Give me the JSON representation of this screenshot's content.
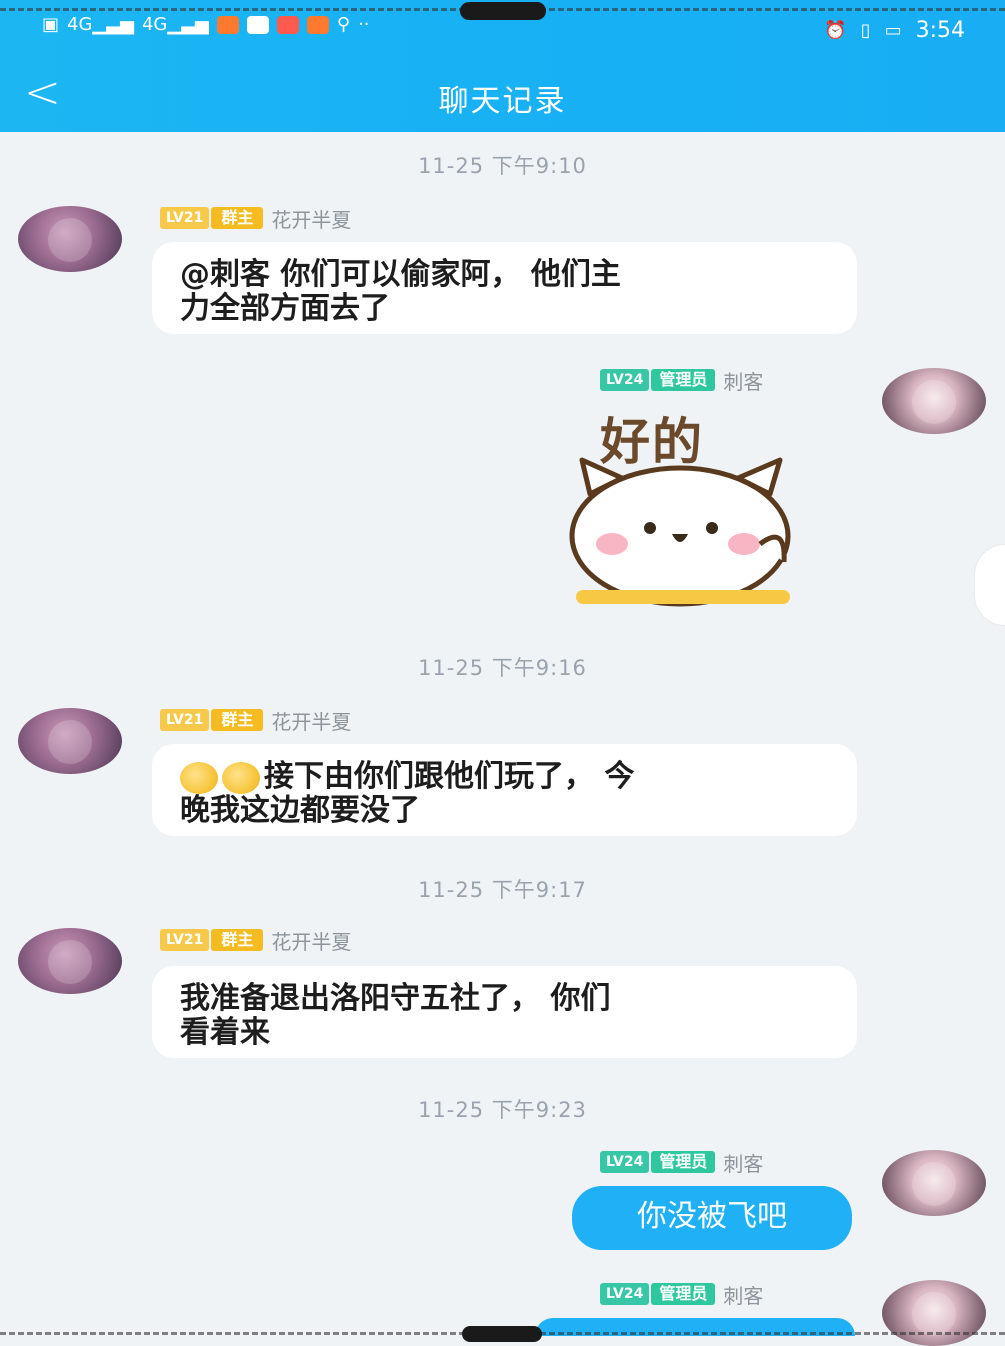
{
  "status_bar": {
    "left_icons": [
      "hd-icon",
      "signal-icon",
      "signal-icon",
      "app-icon",
      "app-icon",
      "app-icon",
      "app-icon",
      "search-icon",
      "more-dots-icon"
    ],
    "signal_label_1": "4G",
    "signal_label_2": "4G",
    "time": "3:54",
    "right_icons": [
      "alarm-icon",
      "vibrate-icon",
      "battery-icon"
    ]
  },
  "nav": {
    "back_label": "<",
    "title": "聊天记录"
  },
  "messages": [
    {
      "timestamp": "11-25 下午9:10",
      "level": "LV21",
      "role": "群主",
      "nickname": "花开半夏",
      "text_line1": "@刺客 你们可以偷家阿， 他们主",
      "text_line2": "力全部方面去了"
    },
    {
      "level": "LV24",
      "role": "管理员",
      "nickname": "刺客",
      "sticker_text": "好的",
      "sticker": "cat-sticker"
    },
    {
      "timestamp": "11-25 下午9:16",
      "level": "LV21",
      "role": "群主",
      "nickname": "花开半夏",
      "text_line1": "接下由你们跟他们玩了， 今",
      "text_line2": "晚我这边都要没了"
    },
    {
      "timestamp": "11-25 下午9:17",
      "level": "LV21",
      "role": "群主",
      "nickname": "花开半夏",
      "text_line1": "我准备退出洛阳守五社了， 你们",
      "text_line2": "看着来"
    },
    {
      "timestamp": "11-25 下午9:23",
      "level": "LV24",
      "role": "管理员",
      "nickname": "刺客",
      "text_line1": "你没被飞吧"
    },
    {
      "level": "LV24",
      "role": "管理员",
      "nickname": "刺客"
    }
  ],
  "colors": {
    "header": "#19b1f4",
    "background": "#f0f3f6",
    "owner_badge": "#f5bc22",
    "admin_badge": "#2ec79e",
    "blue_bubble": "#1fb0f6"
  }
}
